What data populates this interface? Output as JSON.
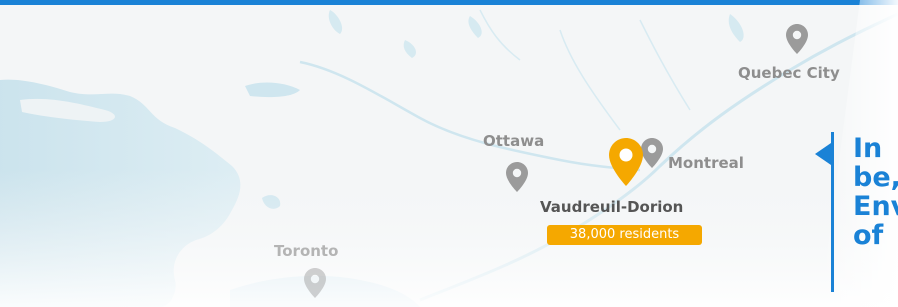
{
  "cities": [
    {
      "id": "quebec-city",
      "label": "Quebec City"
    },
    {
      "id": "montreal",
      "label": "Montreal"
    },
    {
      "id": "ottawa",
      "label": "Ottawa"
    },
    {
      "id": "toronto",
      "label": "Toronto"
    }
  ],
  "highlight": {
    "name": "Vaudreuil-Dorion",
    "badge": "38,000 residents"
  },
  "callout": {
    "lines": [
      "In",
      "be,",
      "Env",
      "of"
    ]
  },
  "colors": {
    "accent_blue": "#1a82d6",
    "highlight_orange": "#f5a800",
    "pin_gray": "#9b9b9b",
    "water": "#cfe6ef"
  }
}
